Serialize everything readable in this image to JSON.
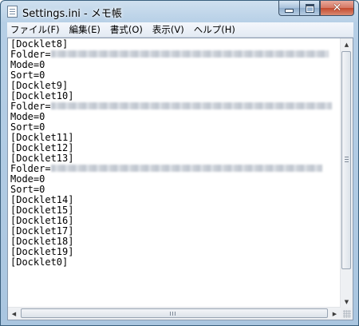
{
  "window": {
    "title": "Settings.ini - メモ帳",
    "controls": {
      "minimize": "minimize",
      "maximize": "maximize",
      "close": "✕"
    }
  },
  "menubar": [
    {
      "label": "ファイル(F)"
    },
    {
      "label": "編集(E)"
    },
    {
      "label": "書式(O)"
    },
    {
      "label": "表示(V)"
    },
    {
      "label": "ヘルプ(H)"
    }
  ],
  "document": {
    "lines": [
      "[Docklet8]",
      "Folder=",
      "Mode=0",
      "Sort=0",
      "[Docklet9]",
      "[Docklet10]",
      "Folder=",
      "Mode=0",
      "Sort=0",
      "[Docklet11]",
      "[Docklet12]",
      "[Docklet13]",
      "Folder=",
      "Mode=0",
      "Sort=0",
      "[Docklet14]",
      "[Docklet15]",
      "[Docklet16]",
      "[Docklet17]",
      "[Docklet18]",
      "[Docklet19]",
      "[Docklet0]"
    ]
  },
  "icons": {
    "app": "notepad-icon",
    "scroll_up": "▲",
    "scroll_down": "▼",
    "scroll_left": "◀",
    "scroll_right": "▶"
  },
  "colors": {
    "frame": "#b6cfe6",
    "close_button": "#c44a2e",
    "text": "#000000",
    "editor_background": "#ffffff"
  }
}
